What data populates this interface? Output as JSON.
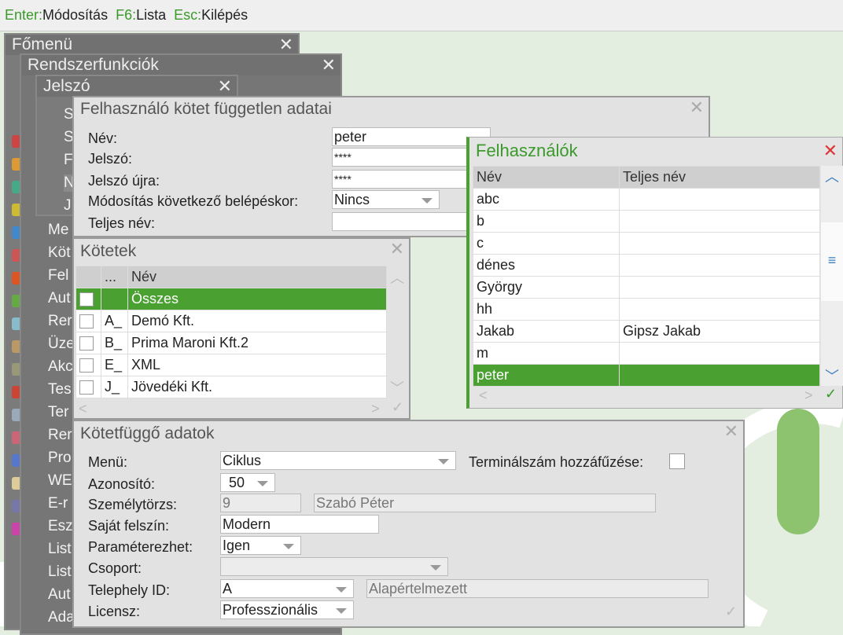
{
  "topbar": [
    {
      "key": "Enter:",
      "label": "Módosítás"
    },
    {
      "key": "F6:",
      "label": "Lista"
    },
    {
      "key": "Esc:",
      "label": "Kilépés"
    }
  ],
  "fomenu": {
    "title": "Főmenü",
    "items": [
      "Me",
      "Köt",
      "Fel",
      "Aut",
      "Rer",
      "Üze",
      "Akc",
      "Tes",
      "Ter",
      "Rer",
      "Pro",
      "WE",
      "E-r",
      "Esz",
      "List",
      "List",
      "Aut",
      "Ada"
    ]
  },
  "rendszer": {
    "title": "Rendszerfunkciók",
    "items": [
      "S",
      "S",
      "F",
      "N",
      "J"
    ]
  },
  "jelszo": {
    "title": "Jelszó"
  },
  "fuggetlen": {
    "title": "Felhasználó kötet független adatai",
    "nev_label": "Név:",
    "nev": "peter",
    "jelszo_label": "Jelszó:",
    "jelszo": "****",
    "jelszo2_label": "Jelszó újra:",
    "jelszo2": "****",
    "mod_label": "Módosítás következő belépéskor:",
    "mod": "Nincs",
    "teljes_label": "Teljes név:",
    "teljes": ""
  },
  "kotetek": {
    "title": "Kötetek",
    "col_dots": "...",
    "col_nev": "Név",
    "rows": [
      {
        "checked": true,
        "code": "",
        "name": "Összes"
      },
      {
        "checked": false,
        "code": "A_",
        "name": "Demó Kft."
      },
      {
        "checked": false,
        "code": "B_",
        "name": "Prima Maroni Kft.2"
      },
      {
        "checked": false,
        "code": "E_",
        "name": "XML"
      },
      {
        "checked": false,
        "code": "J_",
        "name": "Jövedéki Kft."
      }
    ]
  },
  "felhasznalok": {
    "title": "Felhasználók",
    "col_nev": "Név",
    "col_teljes": "Teljes név",
    "rows": [
      {
        "nev": "abc",
        "teljes": ""
      },
      {
        "nev": "b",
        "teljes": ""
      },
      {
        "nev": "c",
        "teljes": ""
      },
      {
        "nev": "dénes",
        "teljes": ""
      },
      {
        "nev": "György",
        "teljes": ""
      },
      {
        "nev": "hh",
        "teljes": ""
      },
      {
        "nev": "Jakab",
        "teljes": "Gipsz Jakab"
      },
      {
        "nev": "m",
        "teljes": ""
      },
      {
        "nev": "peter",
        "teljes": ""
      }
    ],
    "selected": 8
  },
  "kotetfuggo": {
    "title": "Kötetfüggő adatok",
    "menu_label": "Menü:",
    "menu": "Ciklus",
    "term_label": "Terminálszám hozzáfűzése:",
    "azon_label": "Azonosító:",
    "azon": "50",
    "szem_label": "Személytörzs:",
    "szem_id": "9",
    "szem_nev": "Szabó Péter",
    "felszin_label": "Saját felszín:",
    "felszin": "Modern",
    "param_label": "Paraméterezhet:",
    "param": "Igen",
    "csoport_label": "Csoport:",
    "csoport": "",
    "telep_label": "Telephely ID:",
    "telep": "A",
    "telep_nev": "Alapértelmezett",
    "licensz_label": "Licensz:",
    "licensz": "Professzionális"
  },
  "close": "✕"
}
